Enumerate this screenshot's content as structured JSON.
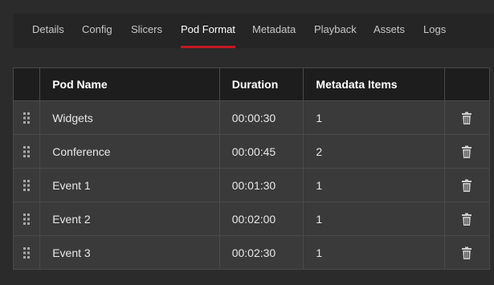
{
  "tabs": [
    {
      "label": "Details",
      "active": false
    },
    {
      "label": "Config",
      "active": false
    },
    {
      "label": "Slicers",
      "active": false
    },
    {
      "label": "Pod Format",
      "active": true
    },
    {
      "label": "Metadata",
      "active": false
    },
    {
      "label": "Playback",
      "active": false
    },
    {
      "label": "Assets",
      "active": false
    },
    {
      "label": "Logs",
      "active": false
    }
  ],
  "table": {
    "headers": {
      "pod_name": "Pod Name",
      "duration": "Duration",
      "metadata_items": "Metadata Items"
    },
    "rows": [
      {
        "pod_name": "Widgets",
        "duration": "00:00:30",
        "metadata_items": "1"
      },
      {
        "pod_name": "Conference",
        "duration": "00:00:45",
        "metadata_items": "2"
      },
      {
        "pod_name": "Event 1",
        "duration": "00:01:30",
        "metadata_items": "1"
      },
      {
        "pod_name": "Event 2",
        "duration": "00:02:00",
        "metadata_items": "1"
      },
      {
        "pod_name": "Event 3",
        "duration": "00:02:30",
        "metadata_items": "1"
      }
    ]
  },
  "colors": {
    "accent": "#c41a22",
    "header_bg": "#1d1d1d",
    "row_bg": "#3a3a3a",
    "page_bg": "#2b2b2b"
  },
  "icons": {
    "row_handle": "drag-handle-icon",
    "row_action": "trash-icon"
  }
}
